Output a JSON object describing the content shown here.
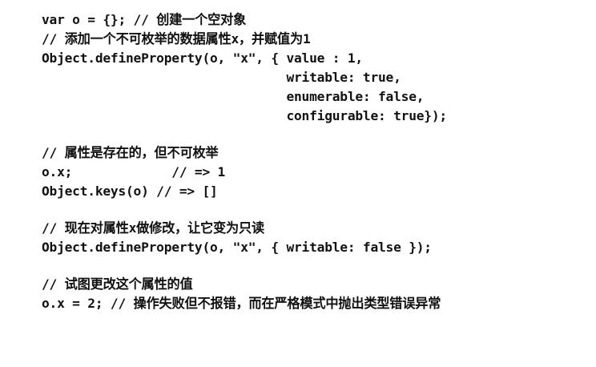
{
  "code": {
    "lines": [
      "var o = {}; // 创建一个空对象",
      "// 添加一个不可枚举的数据属性x，并赋值为1",
      "Object.defineProperty(o, \"x\", { value : 1,",
      "                                writable: true,",
      "                                enumerable: false,",
      "                                configurable: true});",
      "",
      "// 属性是存在的，但不可枚举",
      "o.x;             // => 1",
      "Object.keys(o) // => []",
      "",
      "// 现在对属性x做修改，让它变为只读",
      "Object.defineProperty(o, \"x\", { writable: false });",
      "",
      "// 试图更改这个属性的值",
      "o.x = 2; // 操作失败但不报错，而在严格模式中抛出类型错误异常"
    ]
  }
}
